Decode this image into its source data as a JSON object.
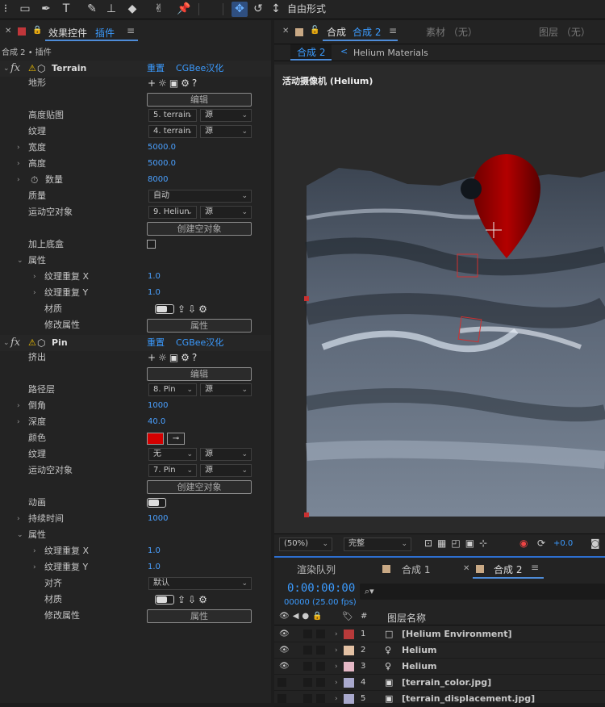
{
  "toolbar": {
    "shape_mode": "自由形式"
  },
  "effects_panel": {
    "title": "效果控件",
    "plugin_tab": "插件",
    "menu": "≡",
    "breadcrumb": "合成 2 • 插件",
    "terrain": {
      "name": "Terrain",
      "reset": "重置",
      "credit": "CGBee汉化",
      "terrain_label": "地形",
      "edit_button": "编辑",
      "height_map_label": "高度贴图",
      "height_map_value": "5. terrain",
      "height_map_source": "源",
      "texture_label": "纹理",
      "texture_value": "4. terrain",
      "texture_source": "源",
      "width_label": "宽度",
      "width_value": "5000.0",
      "height_label": "高度",
      "height_value": "5000.0",
      "count_label": "数量",
      "count_value": "8000",
      "quality_label": "质量",
      "quality_value": "自动",
      "null_label": "运动空对象",
      "null_value": "9. Heliun",
      "null_source": "源",
      "create_null_button": "创建空对象",
      "base_box_label": "加上底盒",
      "attributes_label": "属性",
      "tex_repeat_x_label": "纹理重复 X",
      "tex_repeat_x_value": "1.0",
      "tex_repeat_y_label": "纹理重复 Y",
      "tex_repeat_y_value": "1.0",
      "material_label": "材质",
      "modify_attr_label": "修改属性",
      "attr_button": "属性"
    },
    "pin": {
      "name": "Pin",
      "reset": "重置",
      "credit": "CGBee汉化",
      "extrude_label": "挤出",
      "edit_button": "编辑",
      "path_label": "路径层",
      "path_value": "8. Pin",
      "path_source": "源",
      "bevel_label": "倒角",
      "bevel_value": "1000",
      "depth_label": "深度",
      "depth_value": "40.0",
      "color_label": "颜色",
      "color_value": "#d40000",
      "texture_label": "纹理",
      "texture_value": "无",
      "texture_source": "源",
      "null_label": "运动空对象",
      "null_value": "7. Pin",
      "null_source": "源",
      "create_null_button": "创建空对象",
      "anim_label": "动画",
      "duration_label": "持续时间",
      "duration_value": "1000",
      "attributes_label": "属性",
      "tex_repeat_x_label": "纹理重复 X",
      "tex_repeat_x_value": "1.0",
      "tex_repeat_y_label": "纹理重复 Y",
      "tex_repeat_y_value": "1.0",
      "align_label": "对齐",
      "align_value": "默认",
      "material_label": "材质",
      "modify_attr_label": "修改属性",
      "attr_button": "属性"
    }
  },
  "comp_panel": {
    "tab_comp_prefix": "合成",
    "tab_comp_name": "合成 2",
    "tab_menu": "≡",
    "tab_footage": "素材 （无）",
    "tab_layer": "图层 （无）",
    "flow_comp": "合成 2",
    "flow_arrow": "<",
    "flow_material": "Helium Materials",
    "camera_label": "活动摄像机 (Helium)",
    "zoom": "(50%)",
    "resolution": "完整",
    "exposure": "+0.0"
  },
  "timeline": {
    "tab_render_queue": "渲染队列",
    "tab_comp1": "合成 1",
    "tab_comp2": "合成 2",
    "tab_menu": "≡",
    "timecode": "0:00:00:00",
    "frame_info": "00000 (25.00 fps)",
    "col_hash": "#",
    "col_layer_name": "图层名称",
    "layers": [
      {
        "num": "1",
        "name": "[Helium Environment]",
        "color": "#b83a3a"
      },
      {
        "num": "2",
        "name": "Helium",
        "color": "#e3c1a4"
      },
      {
        "num": "3",
        "name": "Helium",
        "color": "#e5b8c6"
      },
      {
        "num": "4",
        "name": "[terrain_color.jpg]",
        "color": "#a9a9cd"
      },
      {
        "num": "5",
        "name": "[terrain_displacement.jpg]",
        "color": "#a9a9cd"
      }
    ]
  }
}
